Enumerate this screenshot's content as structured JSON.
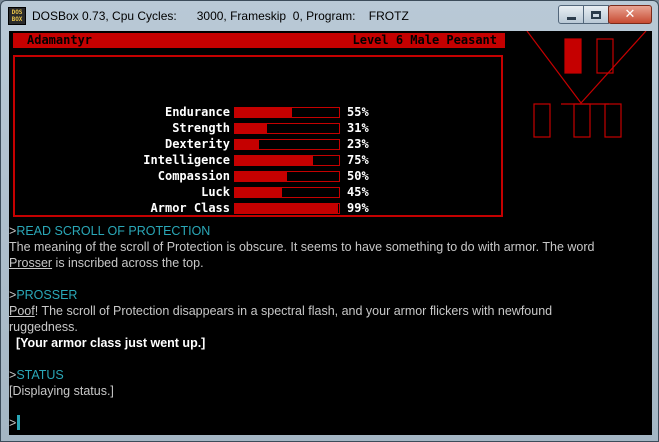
{
  "window": {
    "icon_text": "DOS BOX",
    "title": "DOSBox 0.73, Cpu Cycles:      3000, Frameskip  0, Program:    FROTZ",
    "controls": {
      "close_label": "✕"
    }
  },
  "status_bar": {
    "name": "Adamantyr",
    "level": "Level 6 Male Peasant"
  },
  "stats": [
    {
      "label": "Endurance",
      "percent_text": "55%",
      "value": 55
    },
    {
      "label": "Strength",
      "percent_text": "31%",
      "value": 31
    },
    {
      "label": "Dexterity",
      "percent_text": "23%",
      "value": 23
    },
    {
      "label": "Intelligence",
      "percent_text": "75%",
      "value": 75
    },
    {
      "label": "Compassion",
      "percent_text": "50%",
      "value": 50
    },
    {
      "label": "Luck",
      "percent_text": "45%",
      "value": 45
    },
    {
      "label": "Armor Class",
      "percent_text": "99%",
      "value": 99
    }
  ],
  "log": {
    "cmd1_prompt": ">",
    "cmd1": "READ SCROLL OF PROTECTION",
    "resp1_a": "The meaning of the scroll of Protection is obscure. It seems to have something to do with armor. The word",
    "resp1_word": "Prosser",
    "resp1_b": " is inscribed across the top.",
    "cmd2_prompt": ">",
    "cmd2": "PROSSER",
    "resp2_word": "Poof",
    "resp2_a": "! The scroll of Protection disappears in a spectral flash, and your armor flickers with newfound",
    "resp2_b": "ruggedness.",
    "resp2_bold": "  [Your armor class just went up.]",
    "cmd3_prompt": ">",
    "cmd3": "STATUS",
    "resp3": "[Displaying status.]",
    "input_prompt": ">"
  },
  "colors": {
    "accent_red": "#c50000",
    "command_cyan": "#2aa7b7",
    "text_gray": "#c8c8c8"
  }
}
